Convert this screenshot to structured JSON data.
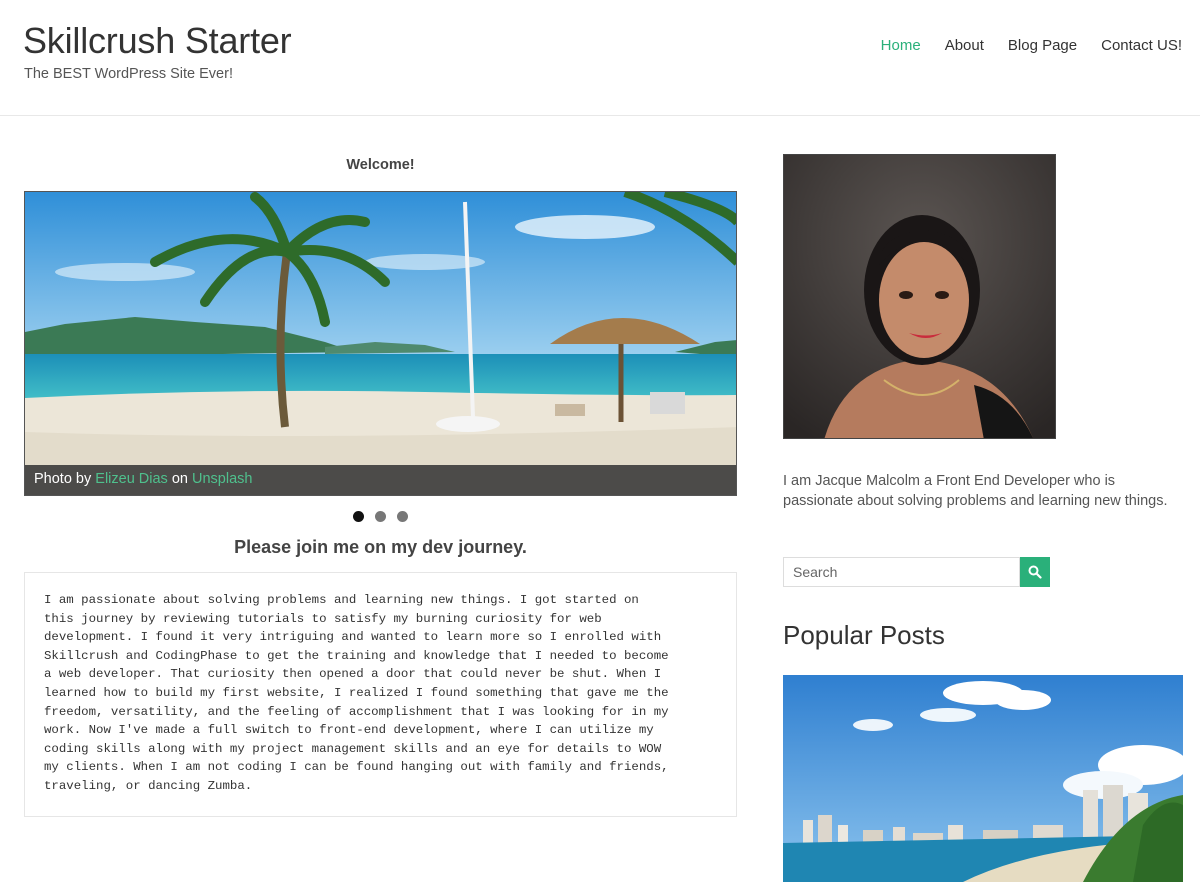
{
  "header": {
    "site_title": "Skillcrush Starter",
    "tagline": "The BEST WordPress Site Ever!",
    "nav": [
      {
        "label": "Home",
        "active": true
      },
      {
        "label": "About",
        "active": false
      },
      {
        "label": "Blog Page",
        "active": false
      },
      {
        "label": "Contact US!",
        "active": false
      }
    ]
  },
  "main": {
    "welcome": "Welcome!",
    "slider": {
      "caption_prefix": "Photo by",
      "author": "Elizeu Dias",
      "caption_on": "on",
      "source": "Unsplash",
      "slide_count": 3,
      "active_slide": 1
    },
    "journey_heading": "Please join me on my dev journey.",
    "bio_lines": [
      "I am passionate about solving problems and learning new things. I got started on",
      "this journey by reviewing tutorials to satisfy my burning curiosity for web",
      "development. I found it very intriguing and wanted to learn more so I enrolled with",
      "Skillcrush and CodingPhase to get the training and knowledge that I needed to become",
      "a web developer. That curiosity then opened a door that could never be shut. When I",
      "learned how to build my first website, I realized I found something that gave me the",
      "freedom, versatility, and the feeling of accomplishment that I was looking for in my",
      "work. Now I've made a full switch to front-end development, where I can utilize my",
      "coding skills along with my project management skills and an eye for details to WOW",
      "my clients. When I am not coding I can be found hanging out with family and friends,",
      "traveling, or dancing Zumba."
    ]
  },
  "sidebar": {
    "about_text": "I am Jacque Malcolm a Front End Developer who is passionate about solving problems and learning new things.",
    "search_placeholder": "Search",
    "popular_title": "Popular Posts"
  },
  "colors": {
    "accent": "#2ab07a",
    "link": "#4fc08d"
  },
  "icons": {
    "search_button": "search-icon"
  }
}
